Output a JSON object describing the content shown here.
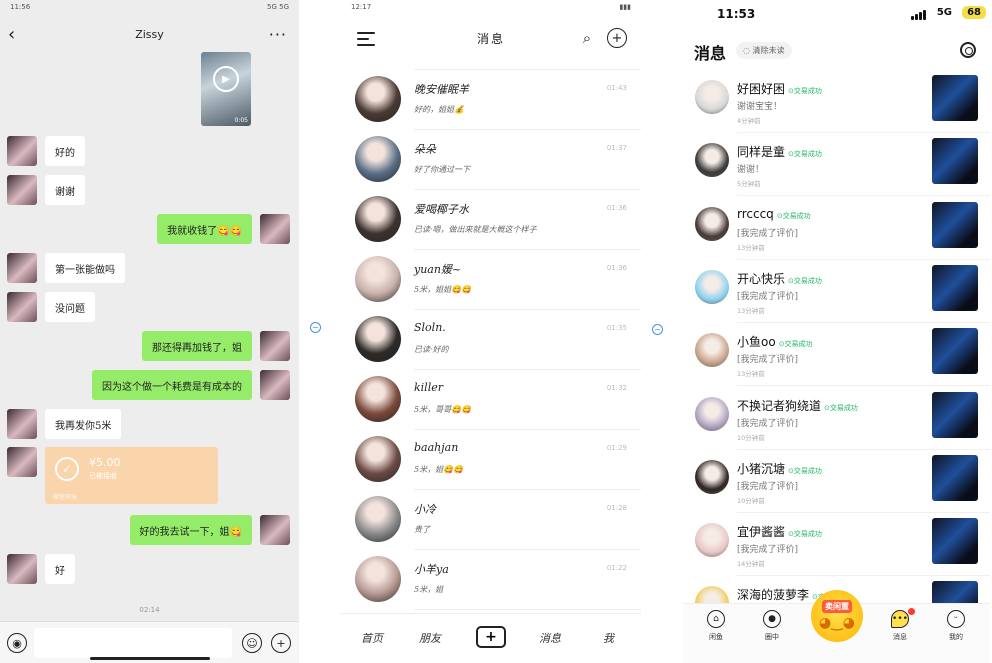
{
  "chat": {
    "status_time": "11:56",
    "status_right": "5G 5G",
    "title": "Zissy",
    "video_duration": "0:05",
    "messages": [
      {
        "side": "left",
        "text": "好的"
      },
      {
        "side": "left",
        "text": "谢谢"
      },
      {
        "side": "right",
        "text": "我就收钱了😋😋"
      },
      {
        "side": "left",
        "text": "第一张能做吗"
      },
      {
        "side": "left",
        "text": "没问题"
      },
      {
        "side": "right",
        "text": "那还得再加钱了，姐"
      },
      {
        "side": "right",
        "text": "因为这个做一个耗费是有成本的"
      },
      {
        "side": "left",
        "text": "我再发你5米"
      },
      {
        "side": "right",
        "text": "好的我去试一下，姐😋"
      },
      {
        "side": "left",
        "text": "好"
      }
    ],
    "transfer": {
      "amount": "¥5.00",
      "status": "已被接收",
      "footer": "微信转账"
    },
    "timestamp": "02:14"
  },
  "list": {
    "status_time": "12:17",
    "title": "消息",
    "chats": [
      {
        "name": "晚安催眠羊",
        "msg": "好的，姐姐💰",
        "time": "01:43",
        "hue": "#4a3a34"
      },
      {
        "name": "朵朵",
        "msg": "好了你通过一下",
        "time": "01:37",
        "hue": "#5a6f88"
      },
      {
        "name": "爱喝椰子水",
        "msg": "已读·嗯，做出来就是大概这个样子",
        "time": "01:36",
        "hue": "#3e3230"
      },
      {
        "name": "yuan媛~",
        "msg": "5米，姐姐😋😋",
        "time": "01:36",
        "hue": "#c9b3ac"
      },
      {
        "name": "Sloln.",
        "msg": "已读·好的",
        "time": "01:35",
        "hue": "#2d2a28"
      },
      {
        "name": "killer",
        "msg": "5米，哥哥😋😋",
        "time": "01:32",
        "hue": "#7b4a3c"
      },
      {
        "name": "baahjan",
        "msg": "5米，姐😋😋",
        "time": "01:29",
        "hue": "#6c4b44"
      },
      {
        "name": "小冷",
        "msg": "贵了",
        "time": "01:28",
        "hue": "#8c8c8c"
      },
      {
        "name": "小羊ya",
        "msg": "5米，姐",
        "time": "01:22",
        "hue": "#b89b95"
      }
    ],
    "tabs": [
      "首页",
      "朋友",
      "",
      "消息",
      "我"
    ]
  },
  "xianyu": {
    "status_time": "11:53",
    "network": "5G",
    "battery": "68",
    "title": "消息",
    "clear_label": "清除未读",
    "badge": "交易成功",
    "rows": [
      {
        "name": "好困好困",
        "msg": "谢谢宝宝！",
        "time": "4分钟前",
        "hue": "#d8d8d8"
      },
      {
        "name": "同样是童",
        "msg": "谢谢！",
        "time": "5分钟前",
        "hue": "#3a3a3a"
      },
      {
        "name": "rrcccq",
        "msg": "[我完成了评价]",
        "time": "13分钟前",
        "hue": "#4a3a38"
      },
      {
        "name": "开心快乐",
        "msg": "[我完成了评价]",
        "time": "13分钟前",
        "hue": "#8fd3ef"
      },
      {
        "name": "小鱼oo",
        "msg": "[我完成了评价]",
        "time": "13分钟前",
        "hue": "#caa58e"
      },
      {
        "name": "不换记者狗绕道",
        "msg": "[我完成了评价]",
        "time": "10分钟前",
        "hue": "#b1a6c4"
      },
      {
        "name": "小猪沉塘",
        "msg": "[我完成了评价]",
        "time": "10分钟前",
        "hue": "#2e2624"
      },
      {
        "name": "宜伊酱酱",
        "msg": "[我完成了评价]",
        "time": "14分钟前",
        "hue": "#e8c7c9"
      },
      {
        "name": "深海的菠萝李",
        "msg": "",
        "time": "",
        "hue": "#f0d05a"
      }
    ],
    "tabs": [
      "闲鱼",
      "圈中",
      "卖闲置",
      "消息",
      "我的"
    ]
  }
}
